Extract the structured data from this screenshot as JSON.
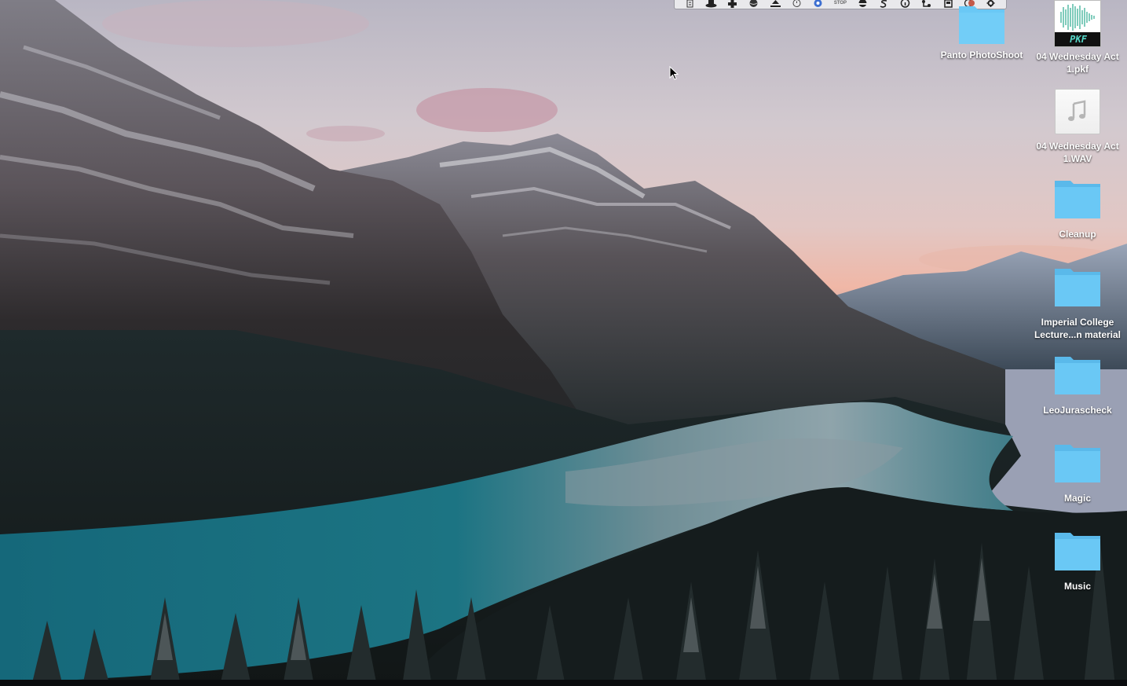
{
  "desktop": {
    "items": [
      {
        "label": "Panto PhotoShoot",
        "kind": "folder"
      },
      {
        "label": "04 Wednesday Act 1.pkf",
        "kind": "pkf-file",
        "badge": "PKF"
      },
      {
        "label": "04 Wednesday Act 1.WAV",
        "kind": "audio-file"
      },
      {
        "label": "Cleanup",
        "kind": "folder"
      },
      {
        "label": "Imperial College Lecture...n material",
        "kind": "folder"
      },
      {
        "label": "LeoJurascheck",
        "kind": "folder"
      },
      {
        "label": "Magic",
        "kind": "folder"
      },
      {
        "label": "Music",
        "kind": "folder"
      }
    ]
  },
  "menubar": {
    "stop_label": "STOP",
    "icons": [
      "notes-icon",
      "hat-icon",
      "plus-cross-icon",
      "sphere-icon",
      "upload-icon",
      "clock-icon",
      "chrome-like-icon",
      "stop-icon",
      "half-circle-icon",
      "s-icon",
      "info-icon",
      "branch-icon",
      "box-icon",
      "moon-icon",
      "gear-icon"
    ]
  },
  "colors": {
    "folder": "#6ac8f5",
    "folder_tab": "#5ab9ea",
    "label_text": "#ffffff",
    "pkf_wave": "#2aa98f",
    "pkf_text": "#56d6c7"
  }
}
